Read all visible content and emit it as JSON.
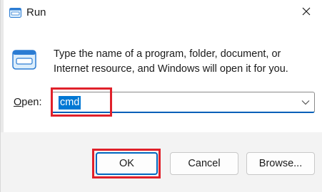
{
  "window": {
    "title": "Run",
    "title_icon": "run-icon",
    "close_icon": "close-icon"
  },
  "content": {
    "icon": "run-icon",
    "description": "Type the name of a program, folder, document, or Internet resource, and Windows will open it for you."
  },
  "open_field": {
    "label": "Open:",
    "value": "cmd",
    "dropdown_icon": "chevron-down-icon"
  },
  "buttons": {
    "ok": "OK",
    "cancel": "Cancel",
    "browse": "Browse..."
  },
  "colors": {
    "accent": "#0078d4",
    "highlight_annotation": "#e0202a",
    "footer_bg": "#f3f3f3"
  }
}
